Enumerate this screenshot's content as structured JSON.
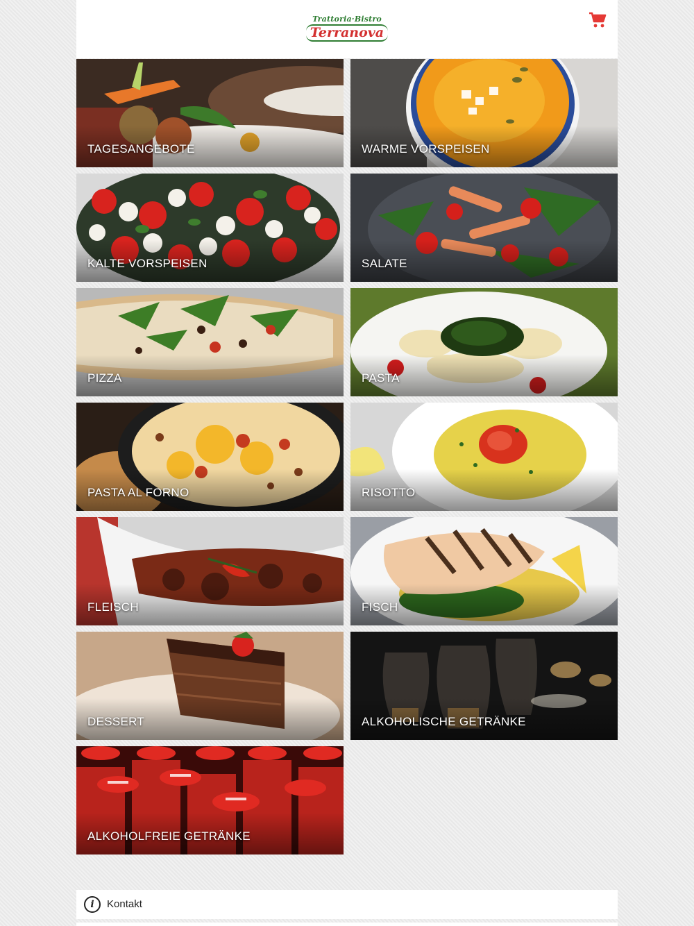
{
  "header": {
    "logo_sub": "Trattoria·Bistro",
    "logo_main": "Terranova",
    "cart_icon": "shopping-cart-icon"
  },
  "colors": {
    "brand_red": "#d32f2f",
    "brand_green": "#2e7d32"
  },
  "categories": [
    {
      "label": "TAGESANGEBOTE"
    },
    {
      "label": "WARME VORSPEISEN"
    },
    {
      "label": "KALTE VORSPEISEN"
    },
    {
      "label": "SALATE"
    },
    {
      "label": "PIZZA"
    },
    {
      "label": "PASTA"
    },
    {
      "label": "PASTA AL FORNO"
    },
    {
      "label": "RISOTTO"
    },
    {
      "label": "FLEISCH"
    },
    {
      "label": "FISCH"
    },
    {
      "label": "DESSERT"
    },
    {
      "label": "ALKOHOLISCHE GETRÄNKE"
    },
    {
      "label": "ALKOHOLFREIE GETRÄNKE"
    }
  ],
  "footer": {
    "kontakt_label": "Kontakt",
    "kontakt_icon": "info-icon"
  }
}
